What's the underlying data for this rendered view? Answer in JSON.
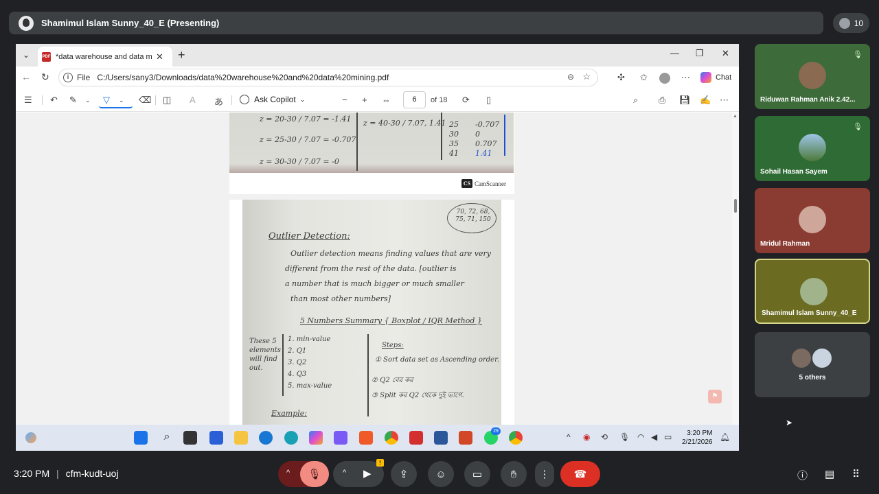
{
  "meet": {
    "presenting_banner": "Shamimul Islam Sunny_40_E (Presenting)",
    "participant_count": "10",
    "meeting_time": "3:20 PM",
    "meeting_code": "cfm-kudt-uoj"
  },
  "browser": {
    "tab_title": "*data warehouse and data mining.",
    "address_scheme": "File",
    "url": "C:/Users/sany3/Downloads/data%20warehouse%20and%20data%20mining.pdf",
    "chat_label": "Chat",
    "toolbar": {
      "ask_copilot": "Ask Copilot",
      "page_number": "6",
      "page_total": "of 18"
    }
  },
  "pdf_content": {
    "page_a_lines": [
      "z = 20-30 / 7.07 = -1.41",
      "z = 25-30 / 7.07 = -0.707",
      "z = 30-30 / 7.07 = -0",
      "z = 40-30 / 7.07, 1.41"
    ],
    "page_a_table": [
      "25",
      "30",
      "35",
      "41"
    ],
    "page_a_table_z": [
      "-0.707",
      "0",
      "0.707",
      "1.41"
    ],
    "camscanner": "CamScanner",
    "note_circle": "70, 72, 68, 75, 71, 150",
    "heading": "Outlier Detection:",
    "paragraph": [
      "Outlier detection means finding values that are very",
      "different from the rest of the data. [outlier is",
      "a number that is much bigger or much smaller",
      "than most other numbers]"
    ],
    "summary_heading": "5 Numbers Summary { Boxplot / IQR Method }",
    "side_note": "These 5 elements will find out.",
    "five_list": [
      "1. min-value",
      "2. Q1",
      "3. Q2",
      "4. Q3",
      "5. max-value"
    ],
    "steps_label": "Steps:",
    "steps": [
      "① Sort data set as Ascending order.",
      "② Q2 বের কর",
      "③ Split কর Q2 থেকে দুই ভাগে."
    ],
    "example": "Example:"
  },
  "taskbar": {
    "clock_time": "3:20 PM",
    "clock_date": "2/21/2026",
    "whatsapp_badge": "29"
  },
  "participants": [
    {
      "name": "Riduwan Rahman Anik 2.42...",
      "muted": true,
      "color": "#3d6b3a"
    },
    {
      "name": "Sohail Hasan Sayem",
      "muted": true,
      "color": "#2f6b34"
    },
    {
      "name": "Mridul Rahman",
      "muted": false,
      "color": "#8a3b32"
    },
    {
      "name": "Shamimul Islam Sunny_40_E",
      "muted": false,
      "color": "#6b6b22"
    }
  ],
  "others_label": "5 others",
  "colors": {
    "meet_bg": "#202124",
    "end_call": "#dc3025",
    "mic_muted": "#f28b82",
    "active_speaker_border": "#d6d68a"
  }
}
